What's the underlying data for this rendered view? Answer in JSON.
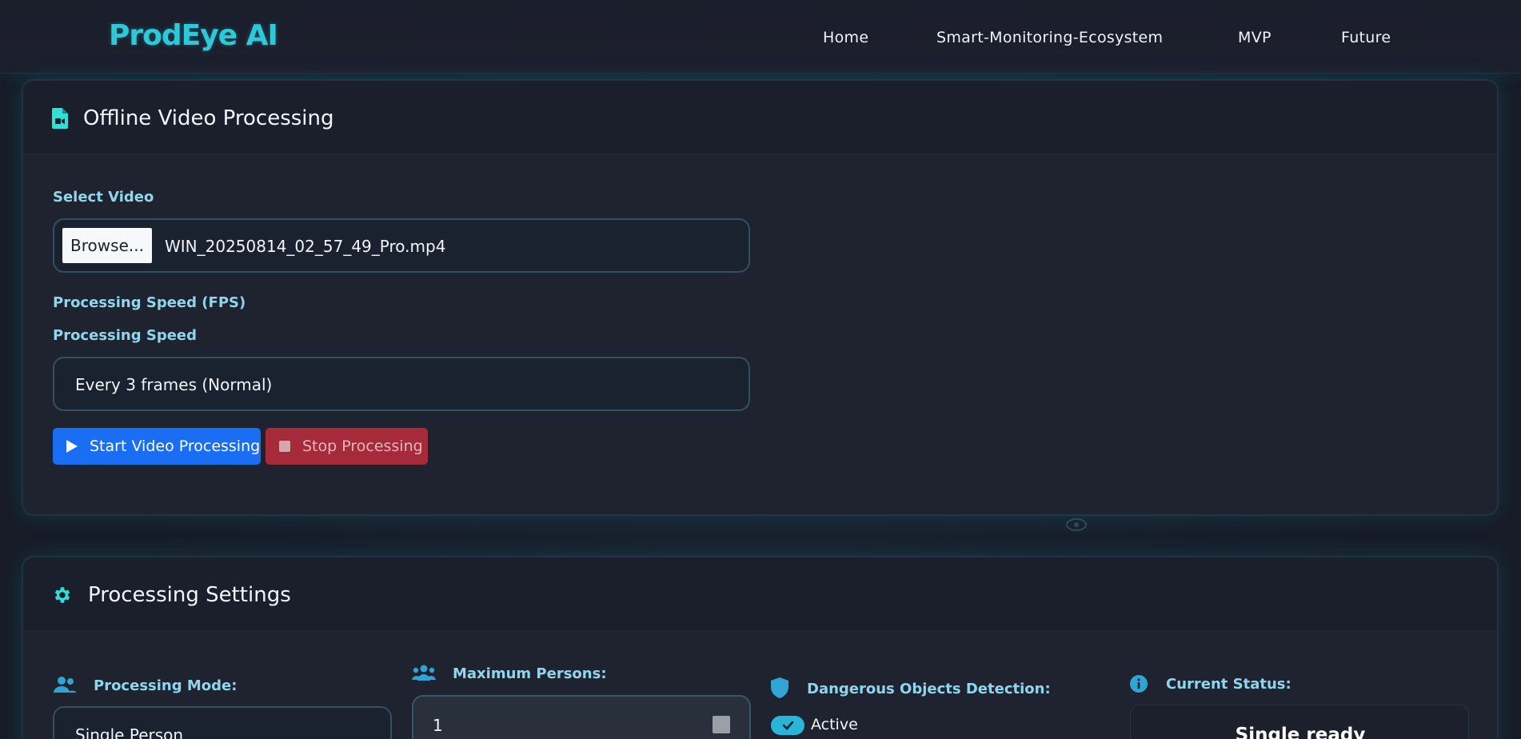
{
  "navbar": {
    "brand": "ProdEye AI",
    "links": [
      {
        "label": "Home"
      },
      {
        "label": "Smart-Monitoring-Ecosystem"
      },
      {
        "label": "MVP"
      },
      {
        "label": "Future"
      }
    ]
  },
  "offline_card": {
    "title": "Offline Video Processing",
    "icon": "file-video-icon",
    "select_video_label": "Select Video",
    "browse_label": "Browse...",
    "file_name": "WIN_20250814_02_57_49_Pro.mp4",
    "fps_label": "Processing Speed (FPS)",
    "speed_label": "Processing Speed",
    "speed_value": "Every 3 frames (Normal)",
    "start_button": "Start Video Processing",
    "stop_button": "Stop Processing"
  },
  "settings_card": {
    "title": "Processing Settings",
    "icon": "gear-icon",
    "mode_label": "Processing Mode:",
    "mode_value": "Single Person",
    "max_persons_label": "Maximum Persons:",
    "max_persons_value": "1",
    "dangerous_label": "Dangerous Objects Detection:",
    "dangerous_state": "Active",
    "status_label": "Current Status:",
    "status_value": "Single ready"
  },
  "colors": {
    "accent": "#2ec8d8",
    "primary": "#1a6ef3",
    "danger": "#a52a3a",
    "label": "#8ed6ec"
  }
}
